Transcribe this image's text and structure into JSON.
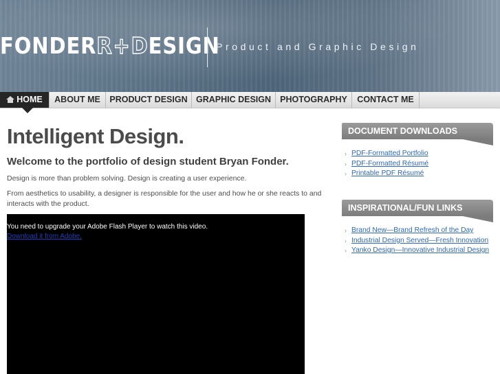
{
  "header": {
    "logo_left": "FONDER",
    "logo_r": "R",
    "logo_plus": "+",
    "logo_d": "D",
    "logo_right": "ESIGN",
    "tagline": "Product and Graphic Design"
  },
  "nav": {
    "items": [
      {
        "label": "HOME",
        "icon": "home-icon",
        "active": true
      },
      {
        "label": "ABOUT ME"
      },
      {
        "label": "PRODUCT DESIGN"
      },
      {
        "label": "GRAPHIC DESIGN"
      },
      {
        "label": "PHOTOGRAPHY"
      },
      {
        "label": "CONTACT ME"
      }
    ]
  },
  "main": {
    "title": "Intelligent Design.",
    "subtitle": "Welcome to the portfolio of design student Bryan Fonder.",
    "paragraphs": [
      "Design is more than problem solving. Design is creating a user experience.",
      "From aesthetics to usability, a designer is responsible for the user and how he or she reacts to and interacts with the product."
    ],
    "video": {
      "message": "You need to upgrade your Adobe Flash Player to watch this video.",
      "link": "Download it from Adobe."
    }
  },
  "sidebar": {
    "downloads": {
      "title": "DOCUMENT DOWNLOADS",
      "links": [
        "PDF-Formatted Portfolio",
        "PDF-Formatted Résumé",
        "Printable PDF Résumé"
      ]
    },
    "inspirational": {
      "title": "INSPIRATIONAL/FUN LINKS",
      "links": [
        "Brand New—Brand Refresh of the Day",
        "Industrial Design Served—Fresh Innovation",
        "Yanko Design—Innovative Industrial Design"
      ]
    }
  },
  "colors": {
    "nav_active": "#262626",
    "link": "#2c68b8",
    "sidebar_header": "#8a8a8a",
    "header_bg": "#5d7488"
  }
}
